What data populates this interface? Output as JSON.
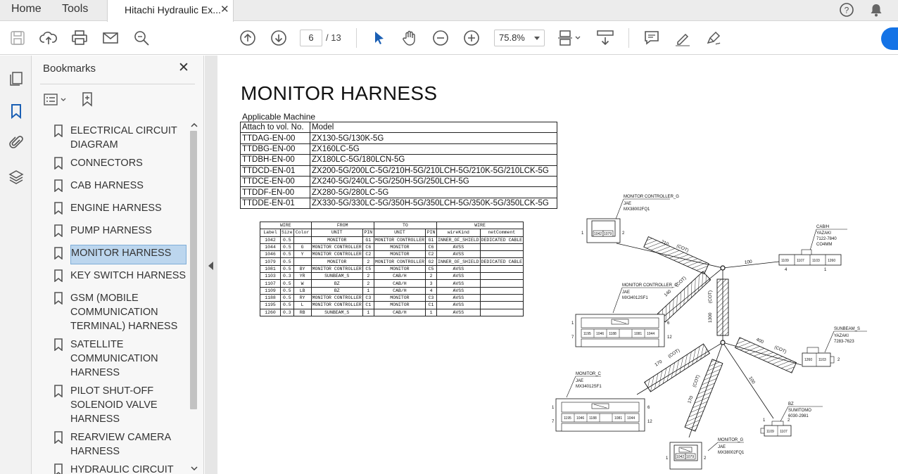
{
  "tabs": {
    "home": "Home",
    "tools": "Tools",
    "document": "Hitachi Hydraulic Ex..."
  },
  "toolbar": {
    "page_current": "6",
    "page_total": "/ 13",
    "zoom": "75.8%"
  },
  "bookmarks": {
    "title": "Bookmarks",
    "items": [
      {
        "label": "ELECTRICAL CIRCUIT DIAGRAM"
      },
      {
        "label": "CONNECTORS"
      },
      {
        "label": "CAB HARNESS"
      },
      {
        "label": "ENGINE HARNESS"
      },
      {
        "label": "PUMP HARNESS"
      },
      {
        "label": "MONITOR HARNESS"
      },
      {
        "label": "KEY SWITCH HARNESS"
      },
      {
        "label": "GSM (MOBILE COMMUNICATION TERMINAL) HARNESS"
      },
      {
        "label": "SATELLITE COMMUNICATION HARNESS"
      },
      {
        "label": "PILOT SHUT-OFF SOLENOID VALVE HARNESS"
      },
      {
        "label": "REARVIEW CAMERA HARNESS"
      },
      {
        "label": "HYDRAULIC CIRCUIT"
      }
    ]
  },
  "document": {
    "title": "MONITOR HARNESS",
    "applicable_label": "Applicable Machine",
    "machine_table": {
      "headers": [
        "Attach to vol. No.",
        "Model"
      ],
      "rows": [
        [
          "TTDAG-EN-00",
          "ZX130-5G/130K-5G"
        ],
        [
          "TTDBG-EN-00",
          "ZX160LC-5G"
        ],
        [
          "TTDBH-EN-00",
          "ZX180LC-5G/180LCN-5G"
        ],
        [
          "TTDCD-EN-01",
          "ZX200-5G/200LC-5G/210H-5G/210LCH-5G/210K-5G/210LCK-5G"
        ],
        [
          "TTDCE-EN-00",
          "ZX240-5G/240LC-5G/250H-5G/250LCH-5G"
        ],
        [
          "TTDDF-EN-00",
          "ZX280-5G/280LC-5G"
        ],
        [
          "TTDDE-EN-01",
          "ZX330-5G/330LC-5G/350H-5G/350LCH-5G/350K-5G/350LCK-5G"
        ]
      ]
    },
    "wire_table": {
      "group_headers": [
        "WIRE",
        "FROM",
        "TO",
        "WIRE"
      ],
      "headers": [
        "Label",
        "Size",
        "Color",
        "UNIT",
        "PIN",
        "UNIT",
        "PIN",
        "wireKind",
        "netComment"
      ],
      "rows": [
        [
          "1042",
          "0.5",
          "",
          "MONITOR",
          "G1",
          "MONITOR CONTROLLER",
          "G1",
          "INNER_OF_SHIELD",
          "DEDICATED CABLE"
        ],
        [
          "1044",
          "0.5",
          "G",
          "MONITOR CONTROLLER",
          "C6",
          "MONITOR",
          "C6",
          "AVSS",
          ""
        ],
        [
          "1046",
          "0.5",
          "Y",
          "MONITOR CONTROLLER",
          "C2",
          "MONITOR",
          "C2",
          "AVSS",
          ""
        ],
        [
          "1079",
          "0.5",
          "",
          "MONITOR",
          "2",
          "MONITOR CONTROLLER",
          "G2",
          "INNER_OF_SHIELD",
          "DEDICATED CABLE"
        ],
        [
          "1081",
          "0.5",
          "BY",
          "MONITOR CONTROLLER",
          "C5",
          "MONITOR",
          "C5",
          "AVSS",
          ""
        ],
        [
          "1103",
          "0.3",
          "YR",
          "SUNBEAM_S",
          "2",
          "CAB/H",
          "2",
          "AVSS",
          ""
        ],
        [
          "1107",
          "0.5",
          "W",
          "BZ",
          "2",
          "CAB/H",
          "3",
          "AVSS",
          ""
        ],
        [
          "1109",
          "0.5",
          "LB",
          "BZ",
          "1",
          "CAB/H",
          "4",
          "AVSS",
          ""
        ],
        [
          "1188",
          "0.5",
          "RY",
          "MONITOR CONTROLLER",
          "C3",
          "MONITOR",
          "C3",
          "AVSS",
          ""
        ],
        [
          "1195",
          "0.5",
          "L",
          "MONITOR CONTROLLER",
          "C1",
          "MONITOR",
          "C1",
          "AVSS",
          ""
        ],
        [
          "1260",
          "0.3",
          "RB",
          "SUNBEAM_S",
          "1",
          "CAB/H",
          "1",
          "AVSS",
          ""
        ]
      ]
    },
    "diagram": {
      "monitor_controller_g": {
        "name": "MONITOR CONTROLLER_G",
        "maker": "JAE",
        "part": "MX38002FQ1",
        "pins": [
          "1042",
          "1079"
        ],
        "pin_left": "1",
        "pin_right": "2"
      },
      "cab_h": {
        "name": "CAB/H",
        "maker": "YAZAKI",
        "part": "7122-7840",
        "extra": "CO4MM",
        "pins": [
          "1109",
          "1107",
          "1103",
          "1260"
        ],
        "pin_left": "4",
        "pin_right": "1"
      },
      "monitor_controller_c": {
        "name": "MONITOR CONTROLLER_C",
        "maker": "JAE",
        "part": "MX34012SF1",
        "pins": [
          "1195",
          "1046",
          "1188",
          "1081",
          "1044"
        ],
        "pin_1": "1",
        "pin_6": "6",
        "pin_7": "7",
        "pin_12": "12"
      },
      "sunbeam_s": {
        "name": "SUNBEAM_S",
        "maker": "YAZAKI",
        "part": "7283-7623",
        "pins": [
          "1260",
          "1103"
        ],
        "pin_right": "2"
      },
      "monitor_c": {
        "name": "MONITOR_C",
        "maker": "JAE",
        "part": "MX34012SF1",
        "pins": [
          "1195",
          "1046",
          "1188",
          "1081",
          "1044"
        ],
        "pin_1": "1",
        "pin_6": "6",
        "pin_7": "7",
        "pin_12": "12"
      },
      "bz": {
        "name": "BZ",
        "maker": "SUMITOMO",
        "part": "6030-2981",
        "pins": [
          "1109",
          "1107"
        ],
        "pin_1": "1",
        "pin_2": "2"
      },
      "monitor_g": {
        "name": "MONITOR_G",
        "maker": "JAE",
        "part": "MX38002FQ1",
        "pins": [
          "1042",
          "1079"
        ],
        "pin_left": "1",
        "pin_right": "2"
      },
      "lengths": {
        "seg_210": "210",
        "seg_100a": "100",
        "seg_140": "140",
        "seg_1300": "1300",
        "seg_400": "400",
        "seg_170a": "170",
        "seg_170b": "170",
        "seg_100b": "100"
      },
      "sheath": "(COT)"
    }
  }
}
